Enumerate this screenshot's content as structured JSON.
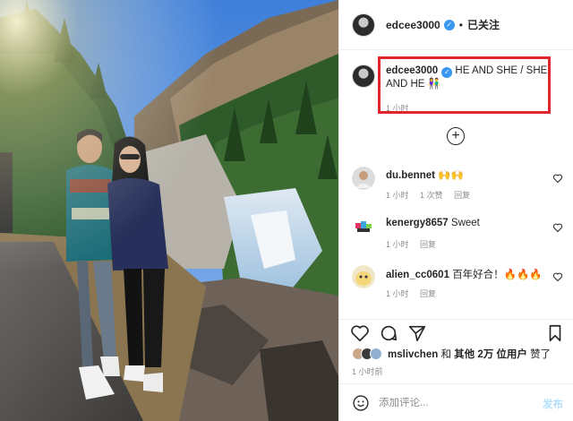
{
  "post": {
    "username": "edcee3000",
    "follow_label": "已关注",
    "dot": "•",
    "caption_user": "edcee3000",
    "caption_text": "HE AND SHE / SHE AND HE",
    "caption_emoji": "👫",
    "caption_time": "1 小时",
    "load_more_icon": "plus-circle-icon"
  },
  "comments": [
    {
      "user": "du.bennet",
      "text": "🙌🙌",
      "time": "1 小时",
      "likes": "1 次赞",
      "reply": "回复"
    },
    {
      "user": "kenergy8657",
      "text": "Sweet",
      "time": "1 小时",
      "reply": "回复"
    },
    {
      "user": "alien_cc0601",
      "text": "百年好合！🔥🔥🔥",
      "time": "1 小时",
      "reply": "回复"
    }
  ],
  "actions": {
    "like_icon": "heart-icon",
    "comment_icon": "comment-bubble-icon",
    "share_icon": "send-icon",
    "save_icon": "bookmark-icon"
  },
  "likes": {
    "user": "mslivchen",
    "middle": " 和 ",
    "others": "其他 2万 位用户",
    "suffix": " 赞了"
  },
  "post_time": "1 小时前",
  "composer": {
    "placeholder": "添加评论...",
    "post_label": "发布",
    "emoji_icon": "smiley-icon"
  },
  "colors": {
    "highlight": "#e0262b",
    "verified": "#3897f0",
    "muted": "#8e8e8e",
    "post_button": "#b2dffc"
  }
}
